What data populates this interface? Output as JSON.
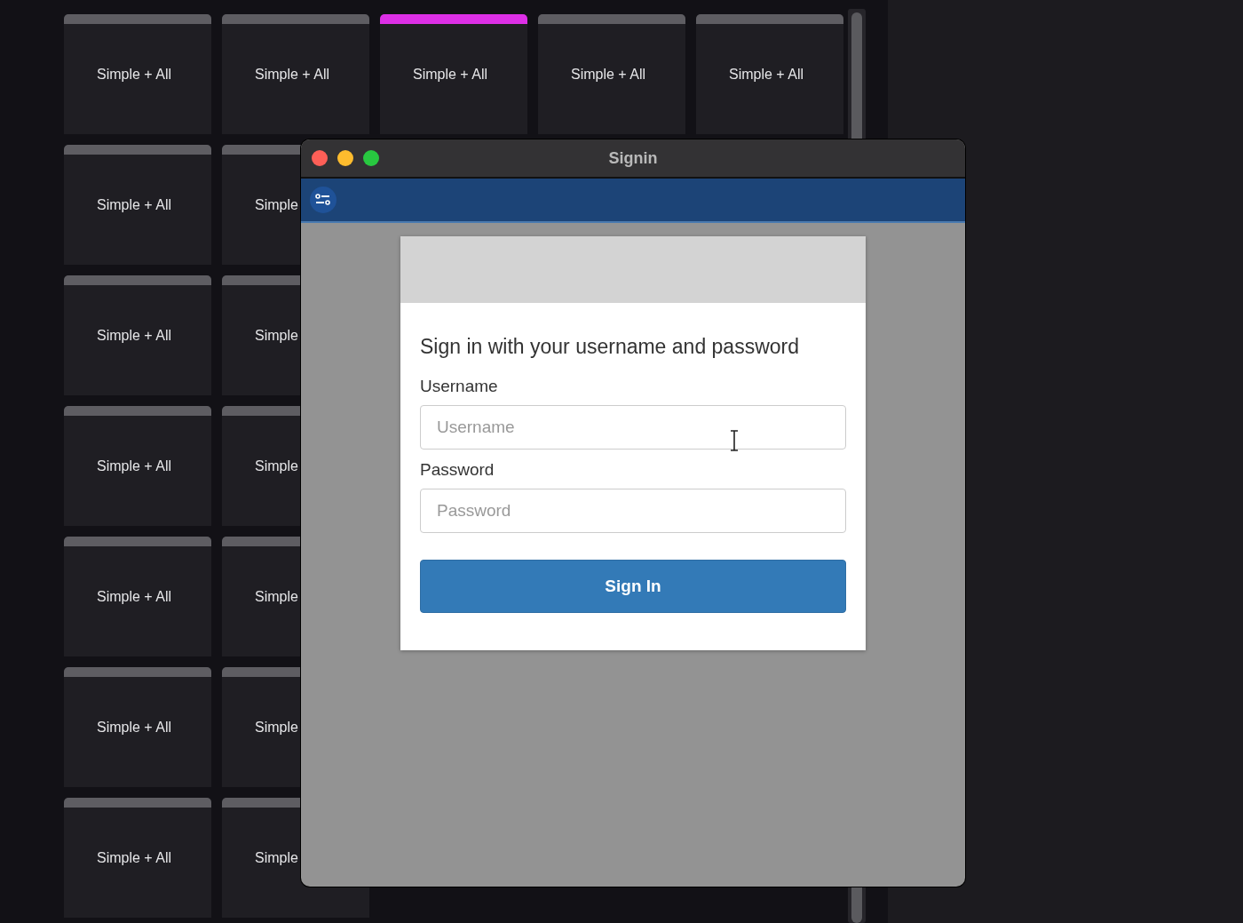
{
  "tile_rows": [
    [
      {
        "label": "Simple + All",
        "highlighted": false
      },
      {
        "label": "Simple + All",
        "highlighted": false
      },
      {
        "label": "Simple + All",
        "highlighted": true
      },
      {
        "label": "Simple + All",
        "highlighted": false
      },
      {
        "label": "Simple + All",
        "highlighted": false
      }
    ],
    [
      {
        "label": "Simple + All",
        "highlighted": false
      },
      {
        "label": "Simple",
        "highlighted": false
      }
    ],
    [
      {
        "label": "Simple + All",
        "highlighted": false
      },
      {
        "label": "Simple",
        "highlighted": false
      }
    ],
    [
      {
        "label": "Simple + All",
        "highlighted": false
      },
      {
        "label": "Simple",
        "highlighted": false
      }
    ],
    [
      {
        "label": "Simple + All",
        "highlighted": false
      },
      {
        "label": "Simple",
        "highlighted": false
      }
    ],
    [
      {
        "label": "Simple + All",
        "highlighted": false
      },
      {
        "label": "Simple",
        "highlighted": false
      }
    ],
    [
      {
        "label": "Simple + All",
        "highlighted": false
      },
      {
        "label": "Simple",
        "highlighted": false
      }
    ]
  ],
  "window": {
    "title": "Signin",
    "form": {
      "heading": "Sign in with your username and password",
      "fields": [
        {
          "label": "Username",
          "placeholder": "Username"
        },
        {
          "label": "Password",
          "placeholder": "Password"
        }
      ],
      "button": "Sign In"
    }
  }
}
